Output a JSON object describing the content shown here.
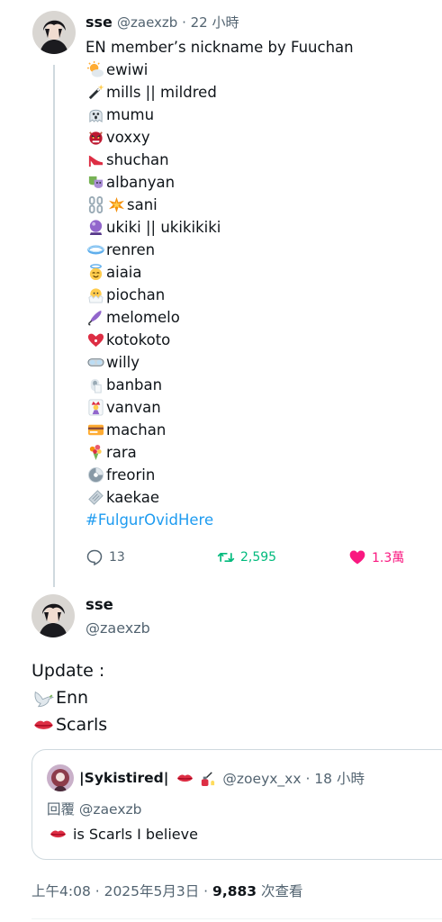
{
  "tweet1": {
    "author_name": "sse",
    "meta": "@zaexzb · 22 小時",
    "title": "EN member’s nickname by Fuuchan",
    "lines": [
      {
        "icon": "sun-behind-cloud-icon",
        "text": "ewiwi"
      },
      {
        "icon": "magic-wand-icon",
        "text": "mills || mildred"
      },
      {
        "icon": "ghost-icon",
        "text": "mumu"
      },
      {
        "icon": "ogre-icon",
        "text": "voxxy"
      },
      {
        "icon": "high-heel-icon",
        "text": "shuchan"
      },
      {
        "icon": "performing-arts-mask-icon",
        "text": "albanyan"
      },
      {
        "icon": "chains-collision-icon",
        "text": "sani"
      },
      {
        "icon": "crystal-ball-icon",
        "text": "ukiki || ukikikiki"
      },
      {
        "icon": "halo-icon",
        "text": "renren"
      },
      {
        "icon": "angel-icon",
        "text": "aiaia"
      },
      {
        "icon": "hatching-chick-icon",
        "text": "piochan"
      },
      {
        "icon": "closed-umbrella-icon",
        "text": "melomelo"
      },
      {
        "icon": "heart-exclamation-icon",
        "text": "kotokoto"
      },
      {
        "icon": "goggles-icon",
        "text": "willy"
      },
      {
        "icon": "toilet-paper-icon",
        "text": "banban"
      },
      {
        "icon": "joker-icon",
        "text": "vanvan"
      },
      {
        "icon": "credit-card-icon",
        "text": "machan"
      },
      {
        "icon": "bouquet-icon",
        "text": "rara"
      },
      {
        "icon": "dvd-icon",
        "text": "freorin"
      },
      {
        "icon": "ticket-icon",
        "text": "kaekae"
      }
    ],
    "hashtag": "#FulgurOvidHere",
    "replies": "13",
    "retweets": "2,595",
    "likes": "1.3萬"
  },
  "tweet2": {
    "author_name": "sse",
    "handle": "@zaexzb",
    "text_lines": [
      {
        "icon": "",
        "text": "Update :"
      },
      {
        "icon": "dove-icon",
        "text": "Enn"
      },
      {
        "icon": "kiss-lips-icon",
        "text": "Scarls"
      }
    ],
    "quote": {
      "author_name": "|Sykistired|",
      "meta": "@zoeyx_xx · 18 小時",
      "reply_to": "回覆 @zaexzb",
      "text": "is Scarls I believe"
    },
    "footer_time": "上午4:08 · 2025年5月3日 · ",
    "footer_views": "9,883",
    "footer_views_label": " 次查看"
  },
  "colors": {
    "accent_blue": "#1d9bf0",
    "retweet_green": "#00ba7c",
    "like_pink": "#f91880",
    "muted": "#536471"
  }
}
